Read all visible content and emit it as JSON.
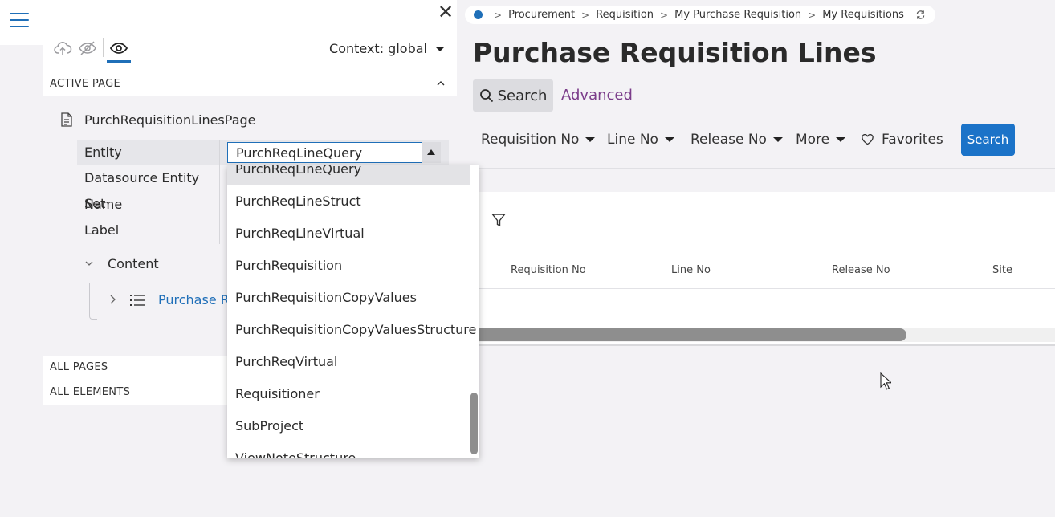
{
  "panel": {
    "context_label": "Context: global",
    "active_page_header": "ACTIVE PAGE",
    "page_name": "PurchRequisitionLinesPage",
    "properties": {
      "entity_label": "Entity",
      "entity_value": "PurchReqLineQuery",
      "datasource_label": "Datasource Entity Set",
      "name_label": "Name",
      "label_label": "Label"
    },
    "content_label": "Content",
    "tree_item_label": "Purchase Re",
    "all_pages_header": "ALL PAGES",
    "all_elements_header": "ALL ELEMENTS"
  },
  "dropdown": {
    "items": [
      "PurchReqLineQuery",
      "PurchReqLineStruct",
      "PurchReqLineVirtual",
      "PurchRequisition",
      "PurchRequisitionCopyValues",
      "PurchRequisitionCopyValuesStructure",
      "PurchReqVirtual",
      "Requisitioner",
      "SubProject",
      "ViewNoteStructure"
    ],
    "selected_index": 0
  },
  "app": {
    "breadcrumb": [
      "Procurement",
      "Requisition",
      "My Purchase Requisition",
      "My Requisitions"
    ],
    "page_title": "Purchase Requisition Lines",
    "search_tab_label": "Search",
    "advanced_label": "Advanced",
    "filters": [
      "Requisition No",
      "Line No",
      "Release No",
      "More"
    ],
    "favorites_label": "Favorites",
    "search_button_label": "Search",
    "columns": [
      "Requisition No",
      "Line No",
      "Release No",
      "Site"
    ]
  },
  "colors": {
    "accent": "#1f6fb8",
    "search_button": "#1b73c8",
    "advanced_link": "#7b3d8a"
  }
}
